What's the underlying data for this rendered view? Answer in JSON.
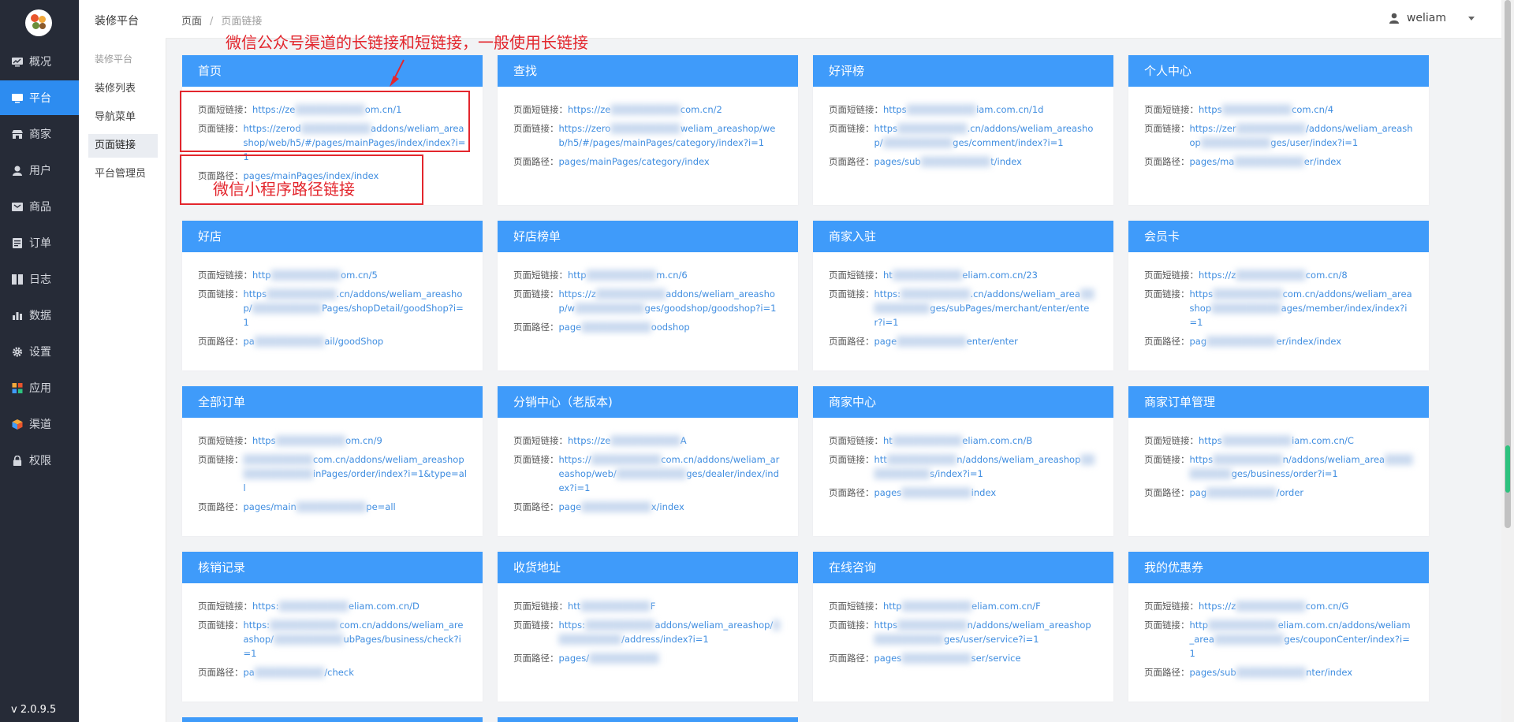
{
  "sidebar": {
    "version": "v 2.0.9.5",
    "items": [
      {
        "label": "概况",
        "icon": "chart-monitor-icon"
      },
      {
        "label": "平台",
        "icon": "monitor-icon"
      },
      {
        "label": "商家",
        "icon": "store-icon"
      },
      {
        "label": "用户",
        "icon": "user-icon"
      },
      {
        "label": "商品",
        "icon": "goods-box-icon"
      },
      {
        "label": "订单",
        "icon": "order-list-icon"
      },
      {
        "label": "日志",
        "icon": "book-icon"
      },
      {
        "label": "数据",
        "icon": "bar-chart-icon"
      },
      {
        "label": "设置",
        "icon": "gear-icon"
      },
      {
        "label": "应用",
        "icon": "apps-grid-icon"
      },
      {
        "label": "渠道",
        "icon": "cube-icon"
      },
      {
        "label": "权限",
        "icon": "lock-icon"
      }
    ],
    "active_index": 1
  },
  "submenu": {
    "title": "装修平台",
    "group": "装修平台",
    "items": [
      "装修列表",
      "导航菜单",
      "页面链接",
      "平台管理员"
    ],
    "active_index": 2
  },
  "breadcrumb": {
    "root": "页面",
    "separator": "/",
    "current": "页面链接"
  },
  "user": {
    "name": "weliam"
  },
  "annotations": {
    "top": "微信公众号渠道的长链接和短链接，一般使用长链接",
    "path": "微信小程序路径链接"
  },
  "colors": {
    "sidebar_bg": "#262b37",
    "accent": "#2d8cf0",
    "card_header": "#3f9bfa",
    "link": "#3f8de0",
    "annotation": "#e3262d"
  },
  "labels": {
    "short": "页面短链接：",
    "long": "页面链接：",
    "path": "页面路径："
  },
  "cards": [
    {
      "title": "首页",
      "short": "https://ze[blur]om.cn/1",
      "long": "https://zerod[blur]addons/weliam_areashop/web/h5/#/pages/mainPages/index/index?i=1",
      "path": "pages/mainPages/index/index"
    },
    {
      "title": "查找",
      "short": "https://ze[blur]com.cn/2",
      "long": "https://zero[blur]weliam_areashop/web/h5/#/pages/mainPages/category/index?i=1",
      "path": "pages/mainPages/category/index"
    },
    {
      "title": "好评榜",
      "short": "https[blur]iam.com.cn/1d",
      "long": "https[blur].cn/addons/weliam_areashop/[blur]ges/comment/index?i=1",
      "path": "pages/sub[blur]t/index"
    },
    {
      "title": "个人中心",
      "short": "https[blur]com.cn/4",
      "long": "https://zer[blur]/addons/weliam_areashop[blur]ges/user/index?i=1",
      "path": "pages/ma[blur]er/index"
    },
    {
      "title": "好店",
      "short": "http[blur]om.cn/5",
      "long": "https[blur].cn/addons/weliam_areashop/[blur]Pages/shopDetail/goodShop?i=1",
      "path": "pa[blur]ail/goodShop"
    },
    {
      "title": "好店榜单",
      "short": "http[blur]m.cn/6",
      "long": "https://z[blur]addons/weliam_areashop/w[blur]ges/goodshop/goodshop?i=1",
      "path": "page[blur]oodshop"
    },
    {
      "title": "商家入驻",
      "short": "ht[blur]eliam.com.cn/23",
      "long": "https:[blur].cn/addons/weliam_area[blur]ges/subPages/merchant/enter/enter?i=1",
      "path": "page[blur]enter/enter"
    },
    {
      "title": "会员卡",
      "short": "https://z[blur]com.cn/8",
      "long": "https[blur]com.cn/addons/weliam_areashop[blur]ages/member/index/index?i=1",
      "path": "pag[blur]er/index/index"
    },
    {
      "title": "全部订单",
      "short": "https[blur]om.cn/9",
      "long": "[blur]com.cn/addons/weliam_areashop[blur]inPages/order/index?i=1&type=all",
      "path": "pages/main[blur]pe=all"
    },
    {
      "title": "分销中心（老版本)",
      "short": "https://ze[blur]A",
      "long": "https://[blur]com.cn/addons/weliam_areashop/web/[blur]ges/dealer/index/index?i=1",
      "path": "page[blur]x/index"
    },
    {
      "title": "商家中心",
      "short": "ht[blur]eliam.com.cn/B",
      "long": "htt[blur]n/addons/weliam_areashop[blur]s/index?i=1",
      "path": "pages[blur]index"
    },
    {
      "title": "商家订单管理",
      "short": "https[blur]iam.com.cn/C",
      "long": "https[blur]n/addons/weliam_area[blur]ges/business/order?i=1",
      "path": "pag[blur]/order"
    },
    {
      "title": "核销记录",
      "short": "https:[blur]eliam.com.cn/D",
      "long": "https:[blur]com.cn/addons/weliam_areashop/[blur]ubPages/business/check?i=1",
      "path": "pa[blur]/check"
    },
    {
      "title": "收货地址",
      "short": "htt[blur]F",
      "long": "https:[blur]addons/weliam_areashop/[blur]/address/index?i=1",
      "path": "pages/[blur]"
    },
    {
      "title": "在线咨询",
      "short": "http[blur]eliam.com.cn/F",
      "long": "https[blur]n/addons/weliam_areashop[blur]ges/user/service?i=1",
      "path": "pages[blur]ser/service"
    },
    {
      "title": "我的优惠券",
      "short": "https://z[blur]com.cn/G",
      "long": "http[blur]eliam.com.cn/addons/weliam_area[blur]ges/couponCenter/index?i=1",
      "path": "pages/sub[blur]nter/index"
    }
  ]
}
